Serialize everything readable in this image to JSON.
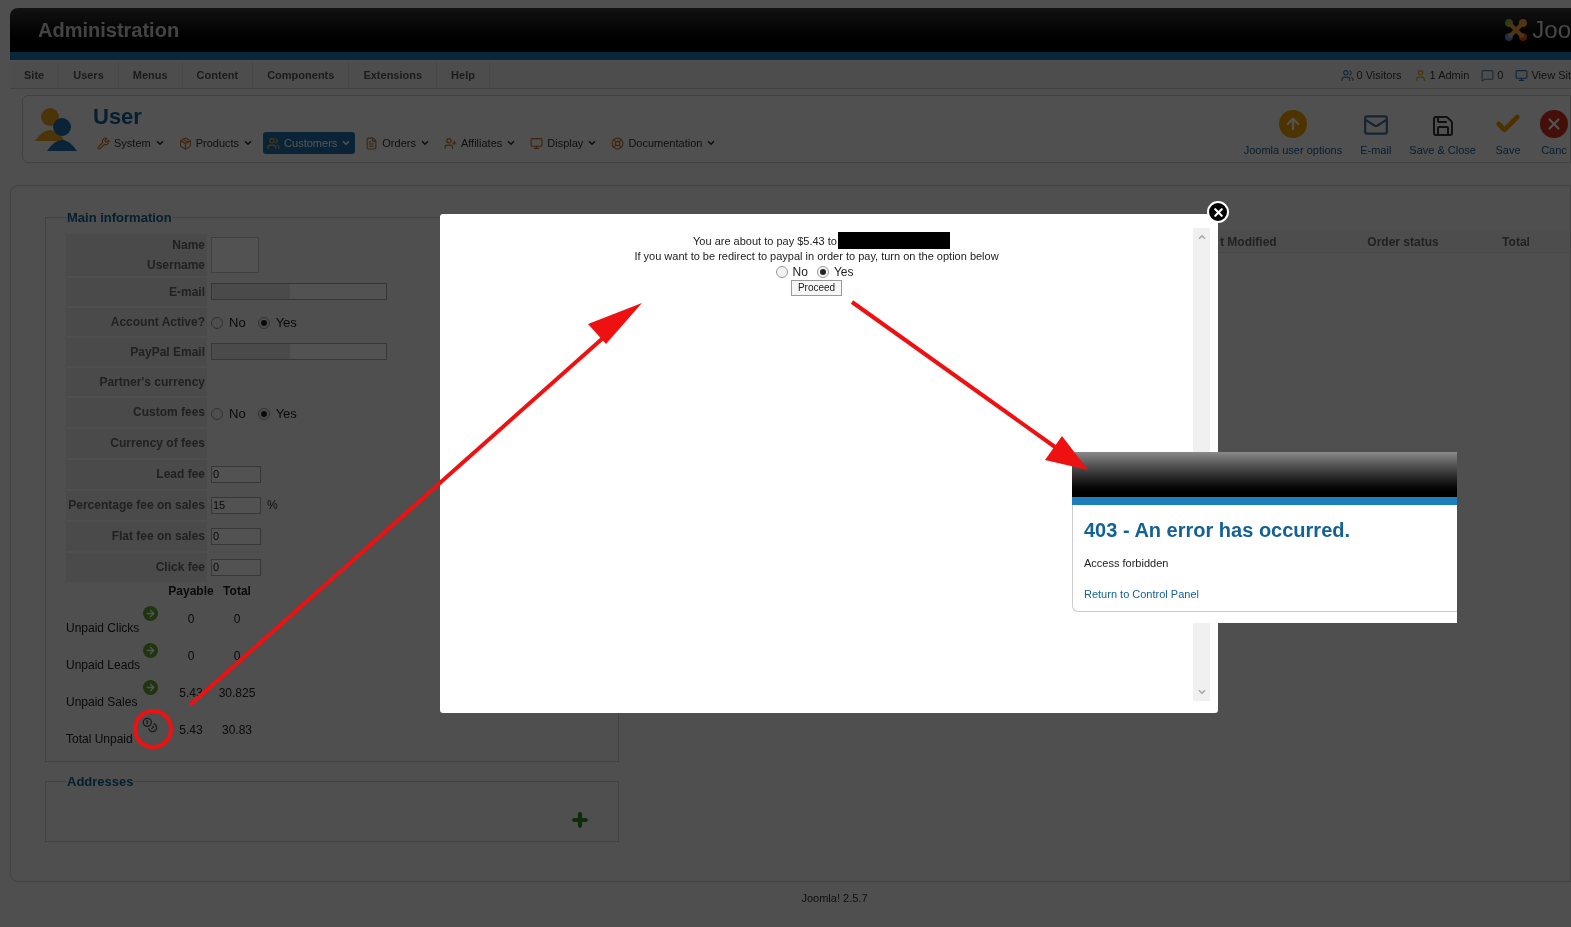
{
  "header": {
    "title": "Administration",
    "logo_text": "Joo"
  },
  "menu": [
    "Site",
    "Users",
    "Menus",
    "Content",
    "Components",
    "Extensions",
    "Help"
  ],
  "status": [
    {
      "kind": "visitors",
      "label": "0 Visitors"
    },
    {
      "kind": "admins",
      "label": "1 Admin"
    },
    {
      "kind": "messages",
      "label": "0"
    },
    {
      "kind": "site",
      "label": "View Sit"
    }
  ],
  "page_title": "User",
  "submenu": [
    {
      "kind": "tools",
      "label": "System",
      "selected": false
    },
    {
      "kind": "box",
      "label": "Products",
      "selected": false
    },
    {
      "kind": "users",
      "label": "Customers",
      "selected": true
    },
    {
      "kind": "list",
      "label": "Orders",
      "selected": false
    },
    {
      "kind": "affiliates",
      "label": "Affiliates",
      "selected": false
    },
    {
      "kind": "display",
      "label": "Display",
      "selected": false
    },
    {
      "kind": "help",
      "label": "Documentation",
      "selected": false
    }
  ],
  "toolbar": [
    {
      "kind": "options",
      "label": "Joomla user options"
    },
    {
      "kind": "mail",
      "label": "E-mail"
    },
    {
      "kind": "save_close",
      "label": "Save & Close"
    },
    {
      "kind": "save",
      "label": "Save"
    },
    {
      "kind": "cancel",
      "label": "Canc"
    }
  ],
  "main_information": {
    "legend": "Main information",
    "fields": [
      {
        "kind": "stacked",
        "labels": [
          "Name",
          "Username"
        ]
      },
      {
        "kind": "redacted_input",
        "label": "E-mail"
      },
      {
        "kind": "radio",
        "label": "Account Active?",
        "options": [
          {
            "label": "No",
            "selected": false
          },
          {
            "label": "Yes",
            "selected": true
          }
        ]
      },
      {
        "kind": "redacted_input",
        "label": "PayPal Email"
      },
      {
        "kind": "empty",
        "label": "Partner's currency"
      },
      {
        "kind": "radio",
        "label": "Custom fees",
        "options": [
          {
            "label": "No",
            "selected": false
          },
          {
            "label": "Yes",
            "selected": true
          }
        ]
      },
      {
        "kind": "empty",
        "label": "Currency of fees"
      },
      {
        "kind": "input",
        "label": "Lead fee",
        "value": "0"
      },
      {
        "kind": "input",
        "label": "Percentage fee on sales",
        "value": "15",
        "suffix": "%"
      },
      {
        "kind": "input",
        "label": "Flat fee on sales",
        "value": "0"
      },
      {
        "kind": "input",
        "label": "Click fee",
        "value": "0"
      }
    ],
    "totals": {
      "columns": [
        "Payable",
        "Total"
      ],
      "rows": [
        {
          "kind": "arrow",
          "label": "Unpaid Clicks",
          "values": [
            "0",
            "0"
          ]
        },
        {
          "kind": "arrow",
          "label": "Unpaid Leads",
          "values": [
            "0",
            "0"
          ]
        },
        {
          "kind": "arrow",
          "label": "Unpaid Sales",
          "values": [
            "5.43",
            "30.825"
          ]
        },
        {
          "kind": "coins",
          "label": "Total Unpaid",
          "values": [
            "5.43",
            "30.83"
          ]
        }
      ]
    }
  },
  "orders_table": {
    "columns": [
      "t Modified",
      "Order status",
      "Total"
    ]
  },
  "addresses": {
    "legend": "Addresses"
  },
  "footer": "Joomla! 2.5.7",
  "modal": {
    "line1": "You are about to pay $5.43 to",
    "line2": "If you want to be redirect to paypal in order to pay, turn on the option below",
    "options": [
      {
        "label": "No",
        "selected": false
      },
      {
        "label": "Yes",
        "selected": true
      }
    ],
    "button": "Proceed"
  },
  "error_page": {
    "title": "403 - An error has occurred.",
    "message": "Access forbidden",
    "link": "Return to Control Panel"
  }
}
